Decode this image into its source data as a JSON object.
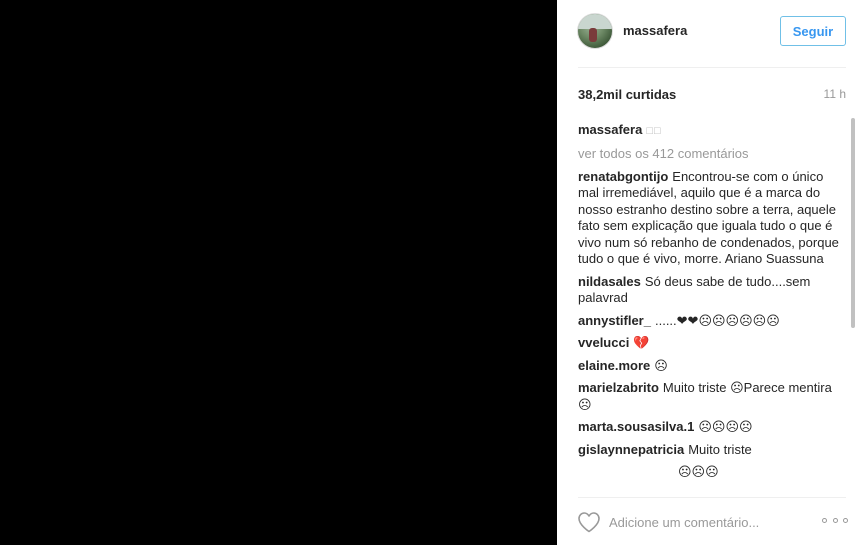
{
  "post": {
    "username": "massafera",
    "follow_label": "Seguir",
    "likes": "38,2mil curtidas",
    "time_ago": "11 h",
    "caption_user": "massafera",
    "caption_text": "□□",
    "view_all": "ver todos os 412 comentários"
  },
  "comments": [
    {
      "user": "renatabgontijo",
      "text": "Encontrou-se com o único mal irremediável, aquilo que é a marca do nosso estranho destino sobre a terra, aquele fato sem explicação que iguala tudo o que é vivo num só rebanho de condenados, porque tudo o que é vivo, morre. Ariano Suassuna"
    },
    {
      "user": "nildasales",
      "text": "Só deus sabe de tudo....sem palavrad"
    },
    {
      "user": "annystifler_",
      "text": "......❤❤☹☹☹☹☹☹"
    },
    {
      "user": "vvelucci",
      "text": "💔"
    },
    {
      "user": "elaine.more",
      "text": "☹"
    },
    {
      "user": "marielzabrito",
      "text": "Muito triste ☹Parece mentira ☹"
    },
    {
      "user": "marta.sousasilva.1",
      "text": "☹☹☹☹"
    },
    {
      "user": "gislaynnepatricia",
      "text": "Muito triste"
    }
  ],
  "cutoff_comment": "☹☹☹",
  "footer": {
    "comment_placeholder": "Adicione um comentário...",
    "like_icon": "heart-outline-icon",
    "more_icon": "more-options-icon"
  },
  "colors": {
    "accent": "#3897f0",
    "text": "#262626",
    "muted": "#999999"
  }
}
